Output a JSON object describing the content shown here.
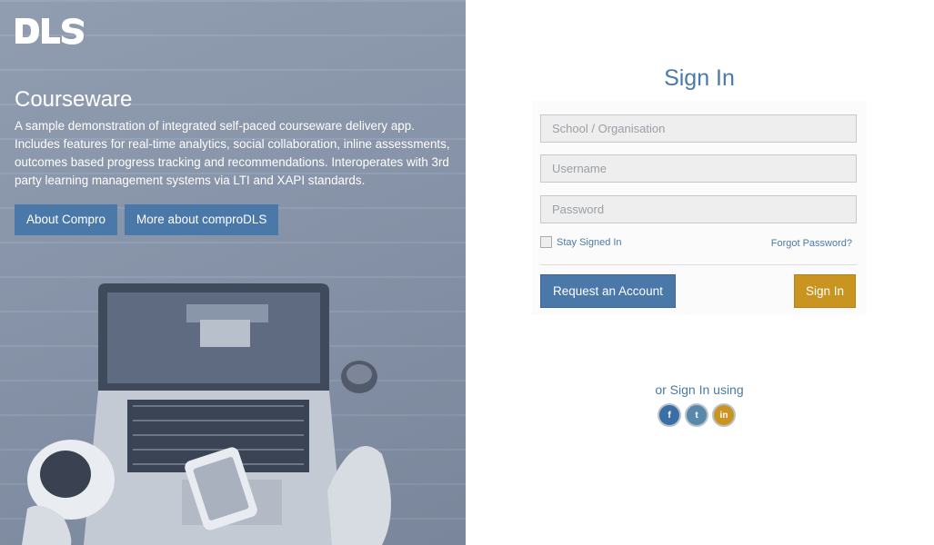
{
  "brand": {
    "logo_text": "DLS"
  },
  "hero": {
    "title": "Courseware",
    "description": "A sample demonstration of integrated self-paced courseware delivery app. Includes features for real-time analytics, social collaboration, inline assessments, outcomes based progress tracking and recommendations. Interoperates with 3rd party learning management systems via LTI and XAPI standards.",
    "buttons": {
      "about": "About Compro",
      "more": "More about comproDLS"
    }
  },
  "signin": {
    "title": "Sign In",
    "fields": {
      "school": {
        "placeholder": "School / Organisation",
        "value": ""
      },
      "username": {
        "placeholder": "Username",
        "value": ""
      },
      "password": {
        "placeholder": "Password",
        "value": ""
      }
    },
    "stay_signed_in": "Stay Signed In",
    "forgot_password": "Forgot Password?",
    "request_account": "Request an Account",
    "submit": "Sign In"
  },
  "social": {
    "label": "or Sign In using",
    "icons": [
      "facebook-icon",
      "twitter-icon",
      "linkedin-icon"
    ],
    "glyphs": {
      "facebook": "f",
      "twitter": "t",
      "linkedin": "in"
    }
  },
  "colors": {
    "primary": "#4a78a8",
    "accent": "#c9941f",
    "hero_overlay": "#8b98ad"
  }
}
